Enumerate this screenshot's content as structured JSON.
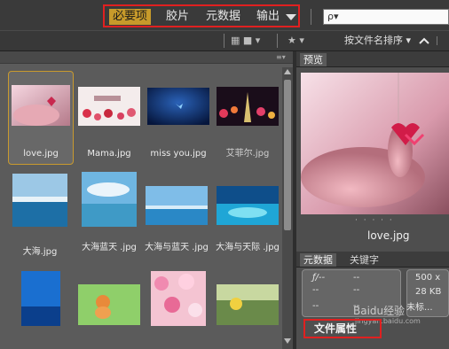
{
  "workspace": {
    "tabs": [
      "必要项",
      "胶片",
      "元数据",
      "输出"
    ],
    "active_index": 0,
    "search_placeholder": "ρ▾"
  },
  "toolbar": {
    "sort_label": "按文件名排序 ▾",
    "star_filter": "★ ▾",
    "view_icons": "▦ ■ ▾"
  },
  "content": {
    "thumbnails": [
      {
        "label": "love.jpg",
        "selected": true
      },
      {
        "label": "Mama.jpg",
        "selected": false
      },
      {
        "label": "miss you.jpg",
        "selected": false
      },
      {
        "label": "艾菲尔.jpg",
        "selected": false
      },
      {
        "label": "大海.jpg",
        "selected": false
      },
      {
        "label": "大海蓝天 .jpg",
        "selected": false
      },
      {
        "label": "大海与蓝天 .jpg",
        "selected": false
      },
      {
        "label": "大海与天际 .jpg",
        "selected": false
      }
    ]
  },
  "preview": {
    "tab_label": "预览",
    "caption": "love.jpg",
    "dots": "· · · · ·"
  },
  "metadata": {
    "tabs": [
      "元数据",
      "关键字"
    ],
    "left": [
      "ƒ/--",
      "--",
      "--",
      "--",
      "--",
      "--"
    ],
    "right": [
      "500 x",
      "28 KB",
      "未标..."
    ],
    "file_properties": "文件属性",
    "watermark": "Baidu经验",
    "watermark_sub": "jingyan.baidu.com"
  },
  "colors": {
    "accent": "#c79a2a",
    "highlight_box": "#e02020"
  }
}
